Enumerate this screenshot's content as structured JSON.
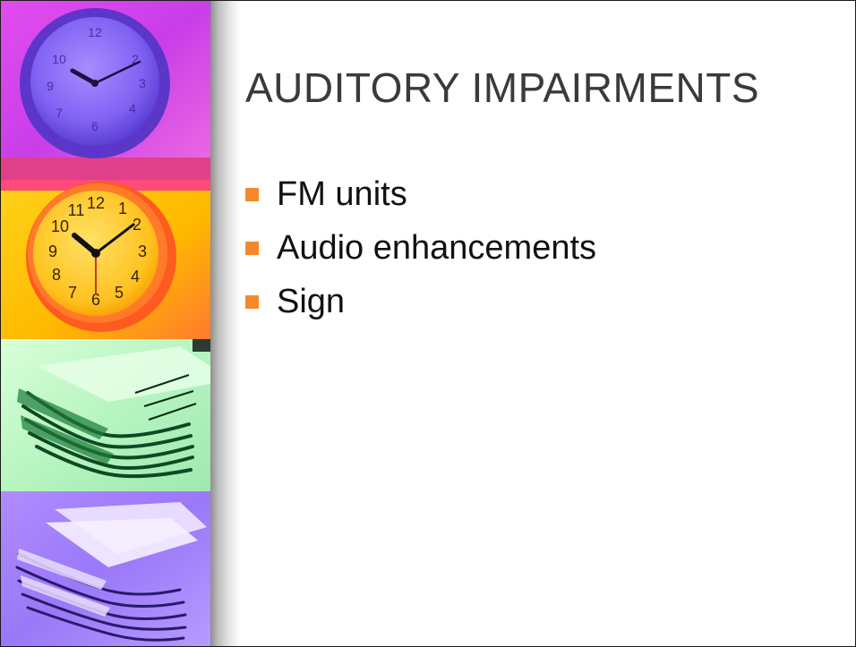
{
  "slide": {
    "title": "AUDITORY IMPAIRMENTS",
    "bullets": [
      "FM units",
      "Audio enhancements",
      "Sign"
    ]
  },
  "colors": {
    "bullet_marker": "#f5892a",
    "title_text": "#3a3a3a",
    "body_text": "#111111"
  },
  "decorative_strip": {
    "panels": [
      "purple-clock-image",
      "orange-clock-image",
      "green-papers-image",
      "violet-papers-image"
    ],
    "clock_numbers": [
      "12",
      "1",
      "2",
      "3",
      "4",
      "5",
      "6",
      "7",
      "8",
      "9",
      "10",
      "11"
    ]
  }
}
